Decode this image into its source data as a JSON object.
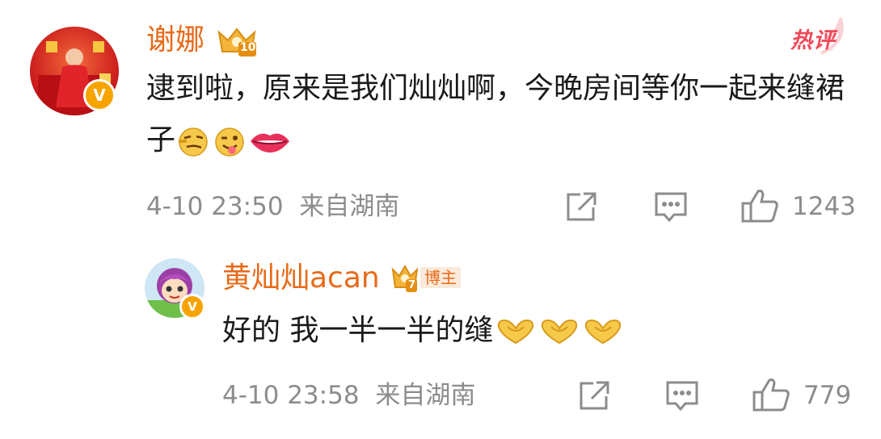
{
  "comments": [
    {
      "username": "谢娜",
      "verified_badge": "V",
      "member_level": "10",
      "hot_tag": "热评",
      "text": "逮到啦，原来是我们灿灿啊，今晚房间等你一起来缝裙子",
      "emojis": [
        "smirk-emoji",
        "wink-tongue-emoji",
        "lips-emoji"
      ],
      "timestamp": "4-10 23:50",
      "location": "来自湖南",
      "like_count": "1243"
    },
    {
      "username": "黄灿灿acan",
      "verified_badge": "V",
      "member_level": "7",
      "author_tag": "博主",
      "text": "好的 我一半一半的缝",
      "emojis": [
        "heart-hands-emoji",
        "heart-hands-emoji",
        "heart-hands-emoji"
      ],
      "timestamp": "4-10 23:58",
      "location": "来自湖南",
      "like_count": "779"
    }
  ],
  "colors": {
    "username": "#e86a19",
    "meta_gray": "#8c8c8c",
    "hot_red": "#f0495a",
    "verified_gold": "#f7a400"
  }
}
